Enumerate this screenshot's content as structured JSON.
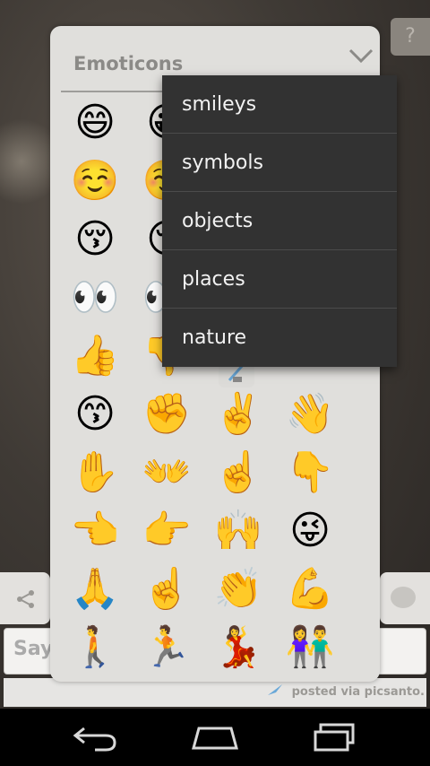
{
  "background": {
    "help_glyph": "?",
    "say_placeholder": "Say",
    "posted_text": "posted via picsanto."
  },
  "panel": {
    "title": "Emoticons",
    "emojis": [
      [
        "😄",
        "😀"
      ],
      [
        "☺️",
        "☺️"
      ],
      [
        "😚",
        "😚"
      ],
      [
        "👀",
        "👀"
      ],
      [
        "👍",
        "👎"
      ],
      [
        "😙",
        "✊",
        "✌️",
        "👋"
      ],
      [
        "✋",
        "👐",
        "☝️",
        "👇"
      ],
      [
        "👈",
        "👉",
        "🙌",
        "😜"
      ],
      [
        "🙏",
        "☝️",
        "👏",
        "💪"
      ],
      [
        "🚶",
        "🏃",
        "💃",
        "👫"
      ]
    ]
  },
  "dropdown": {
    "items": [
      "smileys",
      "symbols",
      "objects",
      "places",
      "nature"
    ]
  },
  "colors": {
    "menu_bg": "#323232",
    "panel_bg": "#e0dfdc",
    "title_color": "#8b8a87"
  }
}
